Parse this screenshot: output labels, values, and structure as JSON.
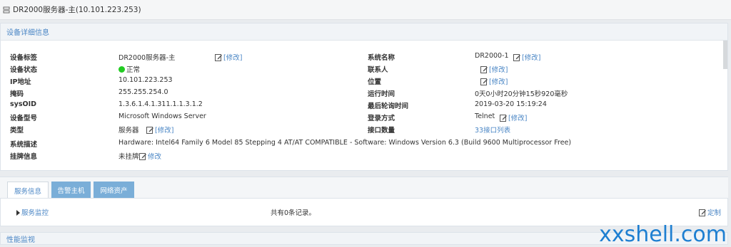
{
  "window": {
    "title": "DR2000服务器-主(10.101.223.253)"
  },
  "detail": {
    "section_title": "设备详细信息",
    "edit_label": "[修改]",
    "edit_label2": "修改",
    "left": [
      {
        "label": "设备标签",
        "value": "DR2000服务器-主"
      },
      {
        "label": "设备状态",
        "value": "正常"
      },
      {
        "label": "IP地址",
        "value": "10.101.223.253"
      },
      {
        "label": "掩码",
        "value": "255.255.254.0"
      },
      {
        "label": "sysOID",
        "value": "1.3.6.1.4.1.311.1.1.3.1.2"
      },
      {
        "label": "设备型号",
        "value": "Microsoft Windows Server"
      },
      {
        "label": "类型",
        "value": "服务器"
      },
      {
        "label": "系统描述",
        "value": "Hardware: Intel64 Family 6 Model 85 Stepping 4 AT/AT COMPATIBLE - Software: Windows Version 6.3 (Build 9600 Multiprocessor Free)"
      },
      {
        "label": "挂牌信息",
        "value": "未挂牌"
      }
    ],
    "right": [
      {
        "label": "系统名称",
        "value": "DR2000-1"
      },
      {
        "label": "联系人",
        "value": ""
      },
      {
        "label": "位置",
        "value": ""
      },
      {
        "label": "运行时间",
        "value": "0天0小时20分钟15秒920毫秒"
      },
      {
        "label": "最后轮询时间",
        "value": "2019-03-20 15:19:24"
      },
      {
        "label": "登录方式",
        "value": "Telnet"
      },
      {
        "label": "接口数量",
        "value": "33",
        "link": "接口列表"
      }
    ]
  },
  "tabs": [
    {
      "label": "服务信息",
      "active": true
    },
    {
      "label": "告警主机",
      "active": false
    },
    {
      "label": "网络资产",
      "active": false
    }
  ],
  "service": {
    "monitor_label": "服务监控",
    "record_text": "共有0条记录。",
    "customize_label": "定制"
  },
  "perf": {
    "title": "性能监视"
  },
  "watermark": "xxshell.com",
  "colors": {
    "accent": "#4a86c5",
    "tab_inactive": "#7aaed8",
    "status_ok": "#22cc22",
    "watermark": "#1e7fd1"
  }
}
